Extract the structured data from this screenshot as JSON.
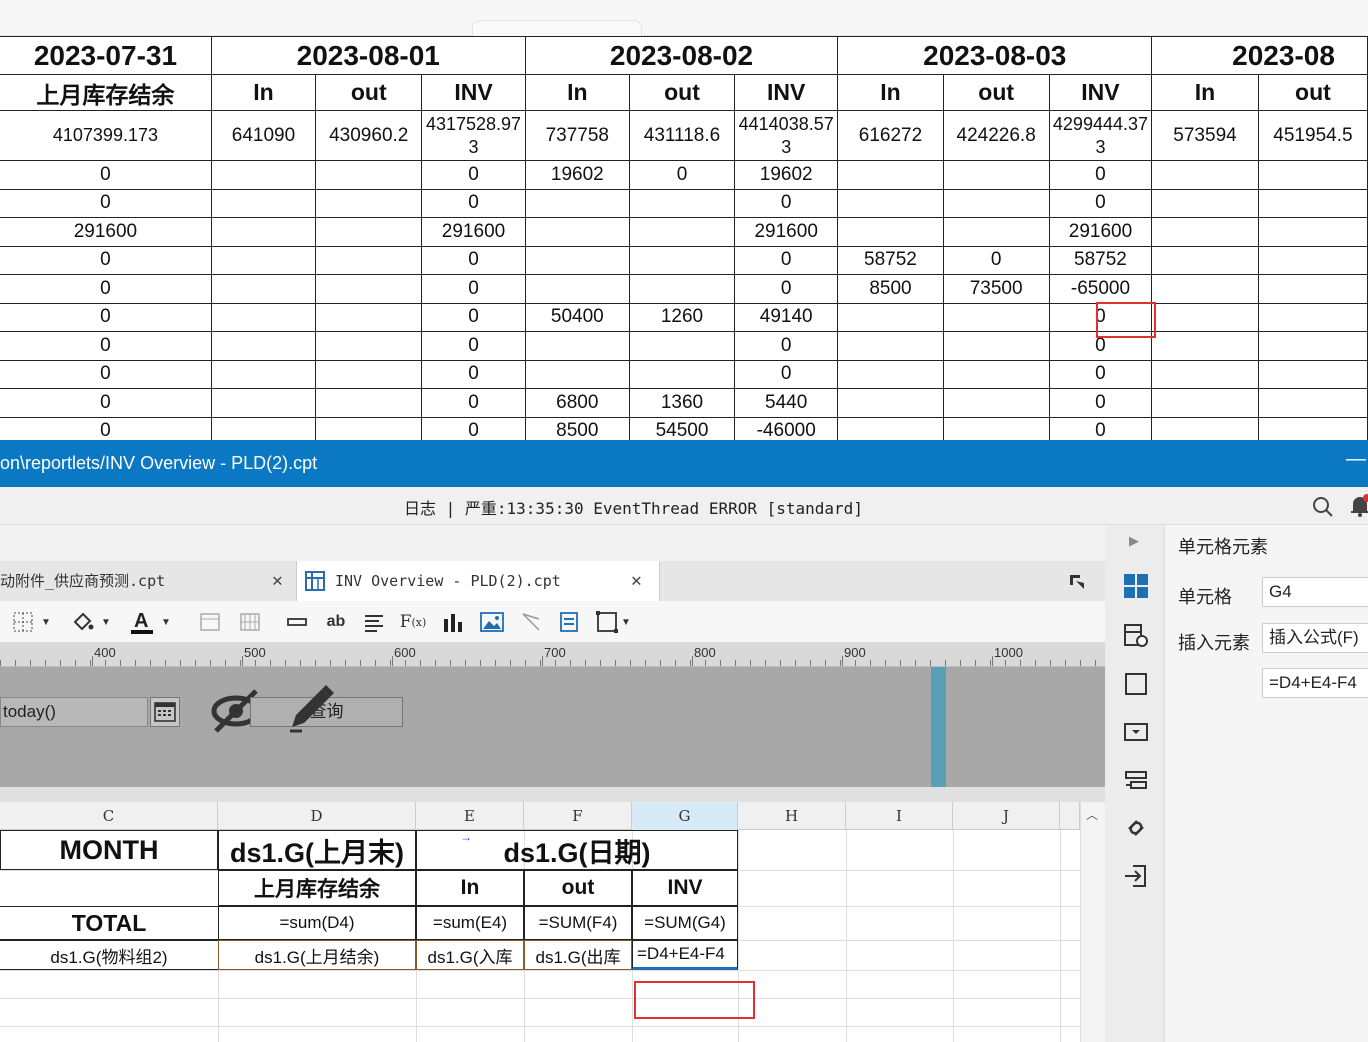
{
  "preview": {
    "dates": [
      "2023-07-31",
      "2023-08-01",
      "2023-08-02",
      "2023-08-03",
      "2023-08"
    ],
    "subheaders": [
      "上月库存结余",
      "In",
      "out",
      "INV",
      "In",
      "out",
      "INV",
      "In",
      "out",
      "INV",
      "In",
      "out"
    ],
    "total_row": [
      "4107399.173",
      "641090",
      "430960.2",
      "4317528.973",
      "737758",
      "431118.6",
      "4414038.573",
      "616272",
      "424226.8",
      "4299444.373",
      "573594",
      "451954.5"
    ],
    "rows": [
      [
        "0",
        "",
        "",
        "0",
        "19602",
        "0",
        "19602",
        "",
        "",
        "0",
        "",
        ""
      ],
      [
        "0",
        "",
        "",
        "0",
        "",
        "",
        "0",
        "",
        "",
        "0",
        "",
        ""
      ],
      [
        "291600",
        "",
        "",
        "291600",
        "",
        "",
        "291600",
        "",
        "",
        "291600",
        "",
        ""
      ],
      [
        "0",
        "",
        "",
        "0",
        "",
        "",
        "0",
        "58752",
        "0",
        "58752",
        "",
        ""
      ],
      [
        "0",
        "",
        "",
        "0",
        "",
        "",
        "0",
        "8500",
        "73500",
        "-65000",
        "",
        ""
      ],
      [
        "0",
        "",
        "",
        "0",
        "50400",
        "1260",
        "49140",
        "",
        "",
        "0",
        "",
        ""
      ],
      [
        "0",
        "",
        "",
        "0",
        "",
        "",
        "0",
        "",
        "",
        "0",
        "",
        ""
      ],
      [
        "0",
        "",
        "",
        "0",
        "",
        "",
        "0",
        "",
        "",
        "0",
        "",
        ""
      ],
      [
        "0",
        "",
        "",
        "0",
        "6800",
        "1360",
        "5440",
        "",
        "",
        "0",
        "",
        ""
      ],
      [
        "0",
        "",
        "",
        "0",
        "8500",
        "54500",
        "-46000",
        "",
        "",
        "0",
        "",
        ""
      ]
    ]
  },
  "designer": {
    "window_title": "on\\reportlets/INV Overview - PLD(2).cpt",
    "minimize_glyph": "—",
    "log_message": "日志 | 严重:13:35:30 EventThread ERROR [standard]",
    "tabs": [
      {
        "label": "动附件_供应商预测.cpt",
        "active": false
      },
      {
        "label": "INV Overview - PLD(2).cpt",
        "active": true
      }
    ],
    "close_glyph": "✕",
    "ruler_labels": [
      "400",
      "500",
      "600",
      "700",
      "800",
      "900",
      "1000"
    ],
    "param_value": "today()",
    "query_label": "查询",
    "col_letters": [
      "C",
      "D",
      "E",
      "F",
      "G",
      "H",
      "I",
      "J"
    ],
    "cells": {
      "c1": "MONTH",
      "d1": "ds1.G(上月末)",
      "ef1": "ds1.G(日期)",
      "d2": "上月库存结余",
      "e2": "In",
      "f2": "out",
      "g2": "INV",
      "c3": "TOTAL",
      "d3": "=sum(D4)",
      "e3": "=sum(E4)",
      "f3": "=SUM(F4)",
      "g3": "=SUM(G4)",
      "c4": "ds1.G(物料组2)",
      "d4": "ds1.G(上月结余)",
      "e4": "ds1.G(入库",
      "f4": "ds1.G(出库",
      "g4": "=D4+E4-F4"
    },
    "panel": {
      "title": "单元格元素",
      "cell_label": "单元格",
      "cell_value": "G4",
      "insert_label": "插入元素",
      "insert_value": "插入公式(F)",
      "formula": "=D4+E4-F4"
    }
  },
  "colors": {
    "titlebar": "#0a78c3",
    "highlight": "#e03030",
    "selected_col": "#d6ebf7"
  }
}
